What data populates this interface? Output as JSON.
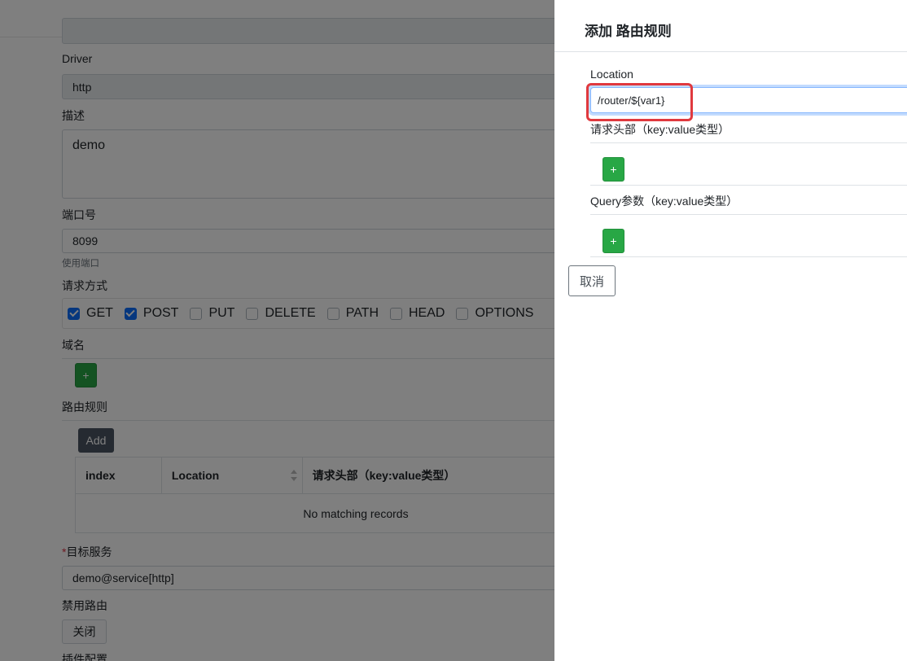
{
  "form": {
    "driver_label": "Driver",
    "driver_value": "http",
    "desc_label": "描述",
    "desc_value": "demo",
    "port_label": "端口号",
    "port_value": "8099",
    "port_hint": "使用端口",
    "method_label": "请求方式",
    "methods": [
      {
        "name": "GET",
        "checked": true
      },
      {
        "name": "POST",
        "checked": true
      },
      {
        "name": "PUT",
        "checked": false
      },
      {
        "name": "DELETE",
        "checked": false
      },
      {
        "name": "PATH",
        "checked": false
      },
      {
        "name": "HEAD",
        "checked": false
      },
      {
        "name": "OPTIONS",
        "checked": false
      }
    ],
    "domain_label": "域名",
    "add_plus": "+",
    "route_rules_label": "路由规则",
    "add_button": "Add",
    "table": {
      "headers": [
        "index",
        "Location",
        "请求头部（key:value类型）"
      ],
      "empty_text": "No matching records"
    },
    "required_mark": "*",
    "target_label": "目标服务",
    "target_value": "demo@service[http]",
    "disable_label": "禁用路由",
    "disable_value": "关闭",
    "plugin_label": "插件配置"
  },
  "drawer": {
    "title": "添加 路由规则",
    "location_label": "Location",
    "location_value": "/router/${var1}",
    "headers_label": "请求头部（key:value类型）",
    "query_label": "Query参数（key:value类型）",
    "plus": "+",
    "cancel_button": "取消"
  },
  "colors": {
    "green": "#28a745",
    "primary": "#0d6efd",
    "highlight": "#e0393e"
  }
}
